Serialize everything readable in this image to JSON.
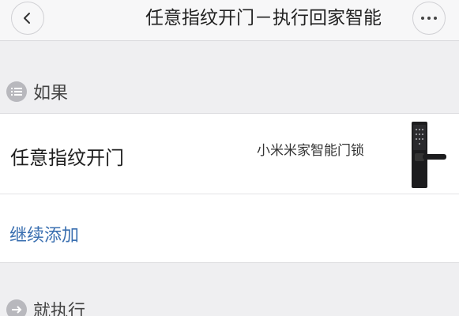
{
  "header": {
    "title": "任意指纹开门－执行回家智能",
    "back_icon": "chevron-left-icon",
    "more_icon": "more-horizontal-icon"
  },
  "condition_section": {
    "label": "如果",
    "icon": "list-icon"
  },
  "trigger": {
    "name": "任意指纹开门",
    "device": "小米米家智能门锁",
    "device_image": "smart-door-lock-icon"
  },
  "add_more_label": "继续添加",
  "action_section": {
    "label": "就执行",
    "icon": "arrow-right-icon"
  },
  "colors": {
    "link": "#3a6fb0",
    "background": "#efeff1",
    "card": "#ffffff"
  }
}
